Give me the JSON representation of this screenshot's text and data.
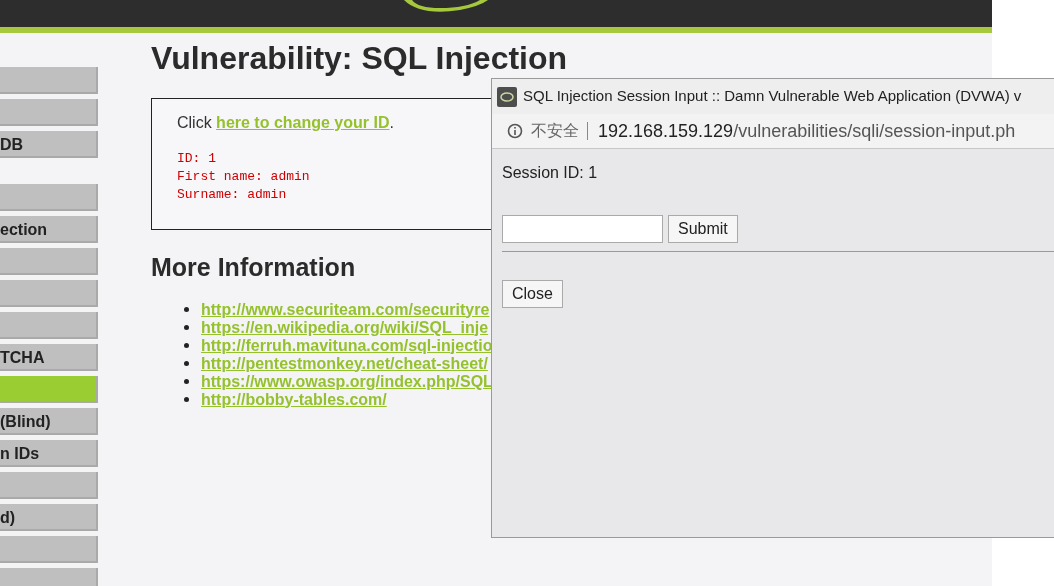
{
  "sidebar": {
    "groups": [
      {
        "items": [
          {
            "selected": false
          },
          {
            "selected": false
          },
          {
            "label": "DB",
            "selected": false
          }
        ]
      },
      {
        "items": [
          {
            "selected": false
          },
          {
            "label": "ection",
            "selected": false
          },
          {
            "selected": false
          },
          {
            "selected": false
          },
          {
            "selected": false
          },
          {
            "label": "TCHA",
            "selected": false
          },
          {
            "selected": true
          },
          {
            "label": "(Blind)",
            "selected": false
          },
          {
            "label": "n IDs",
            "selected": false
          },
          {
            "selected": false
          },
          {
            "label": "d)",
            "selected": false
          },
          {
            "selected": false
          },
          {
            "selected": false
          }
        ]
      }
    ]
  },
  "main": {
    "title": "Vulnerability: SQL Injection",
    "info": {
      "prefix": "Click ",
      "link": "here to change your ID",
      "suffix": ".",
      "output": [
        "ID: 1",
        "First name: admin",
        "Surname: admin"
      ]
    },
    "more_heading": "More Information",
    "links": [
      "http://www.securiteam.com/securityre",
      "https://en.wikipedia.org/wiki/SQL_inje",
      "http://ferruh.mavituna.com/sql-injectio",
      "http://pentestmonkey.net/cheat-sheet/",
      "https://www.owasp.org/index.php/SQL",
      "http://bobby-tables.com/"
    ]
  },
  "popup": {
    "title": "SQL Injection Session Input :: Damn Vulnerable Web Application (DVWA) v",
    "security": "不安全",
    "url_host": "192.168.159.129",
    "url_path": "/vulnerabilities/sqli/session-input.ph",
    "session": "Session ID: 1",
    "submit": "Submit",
    "close": "Close"
  }
}
